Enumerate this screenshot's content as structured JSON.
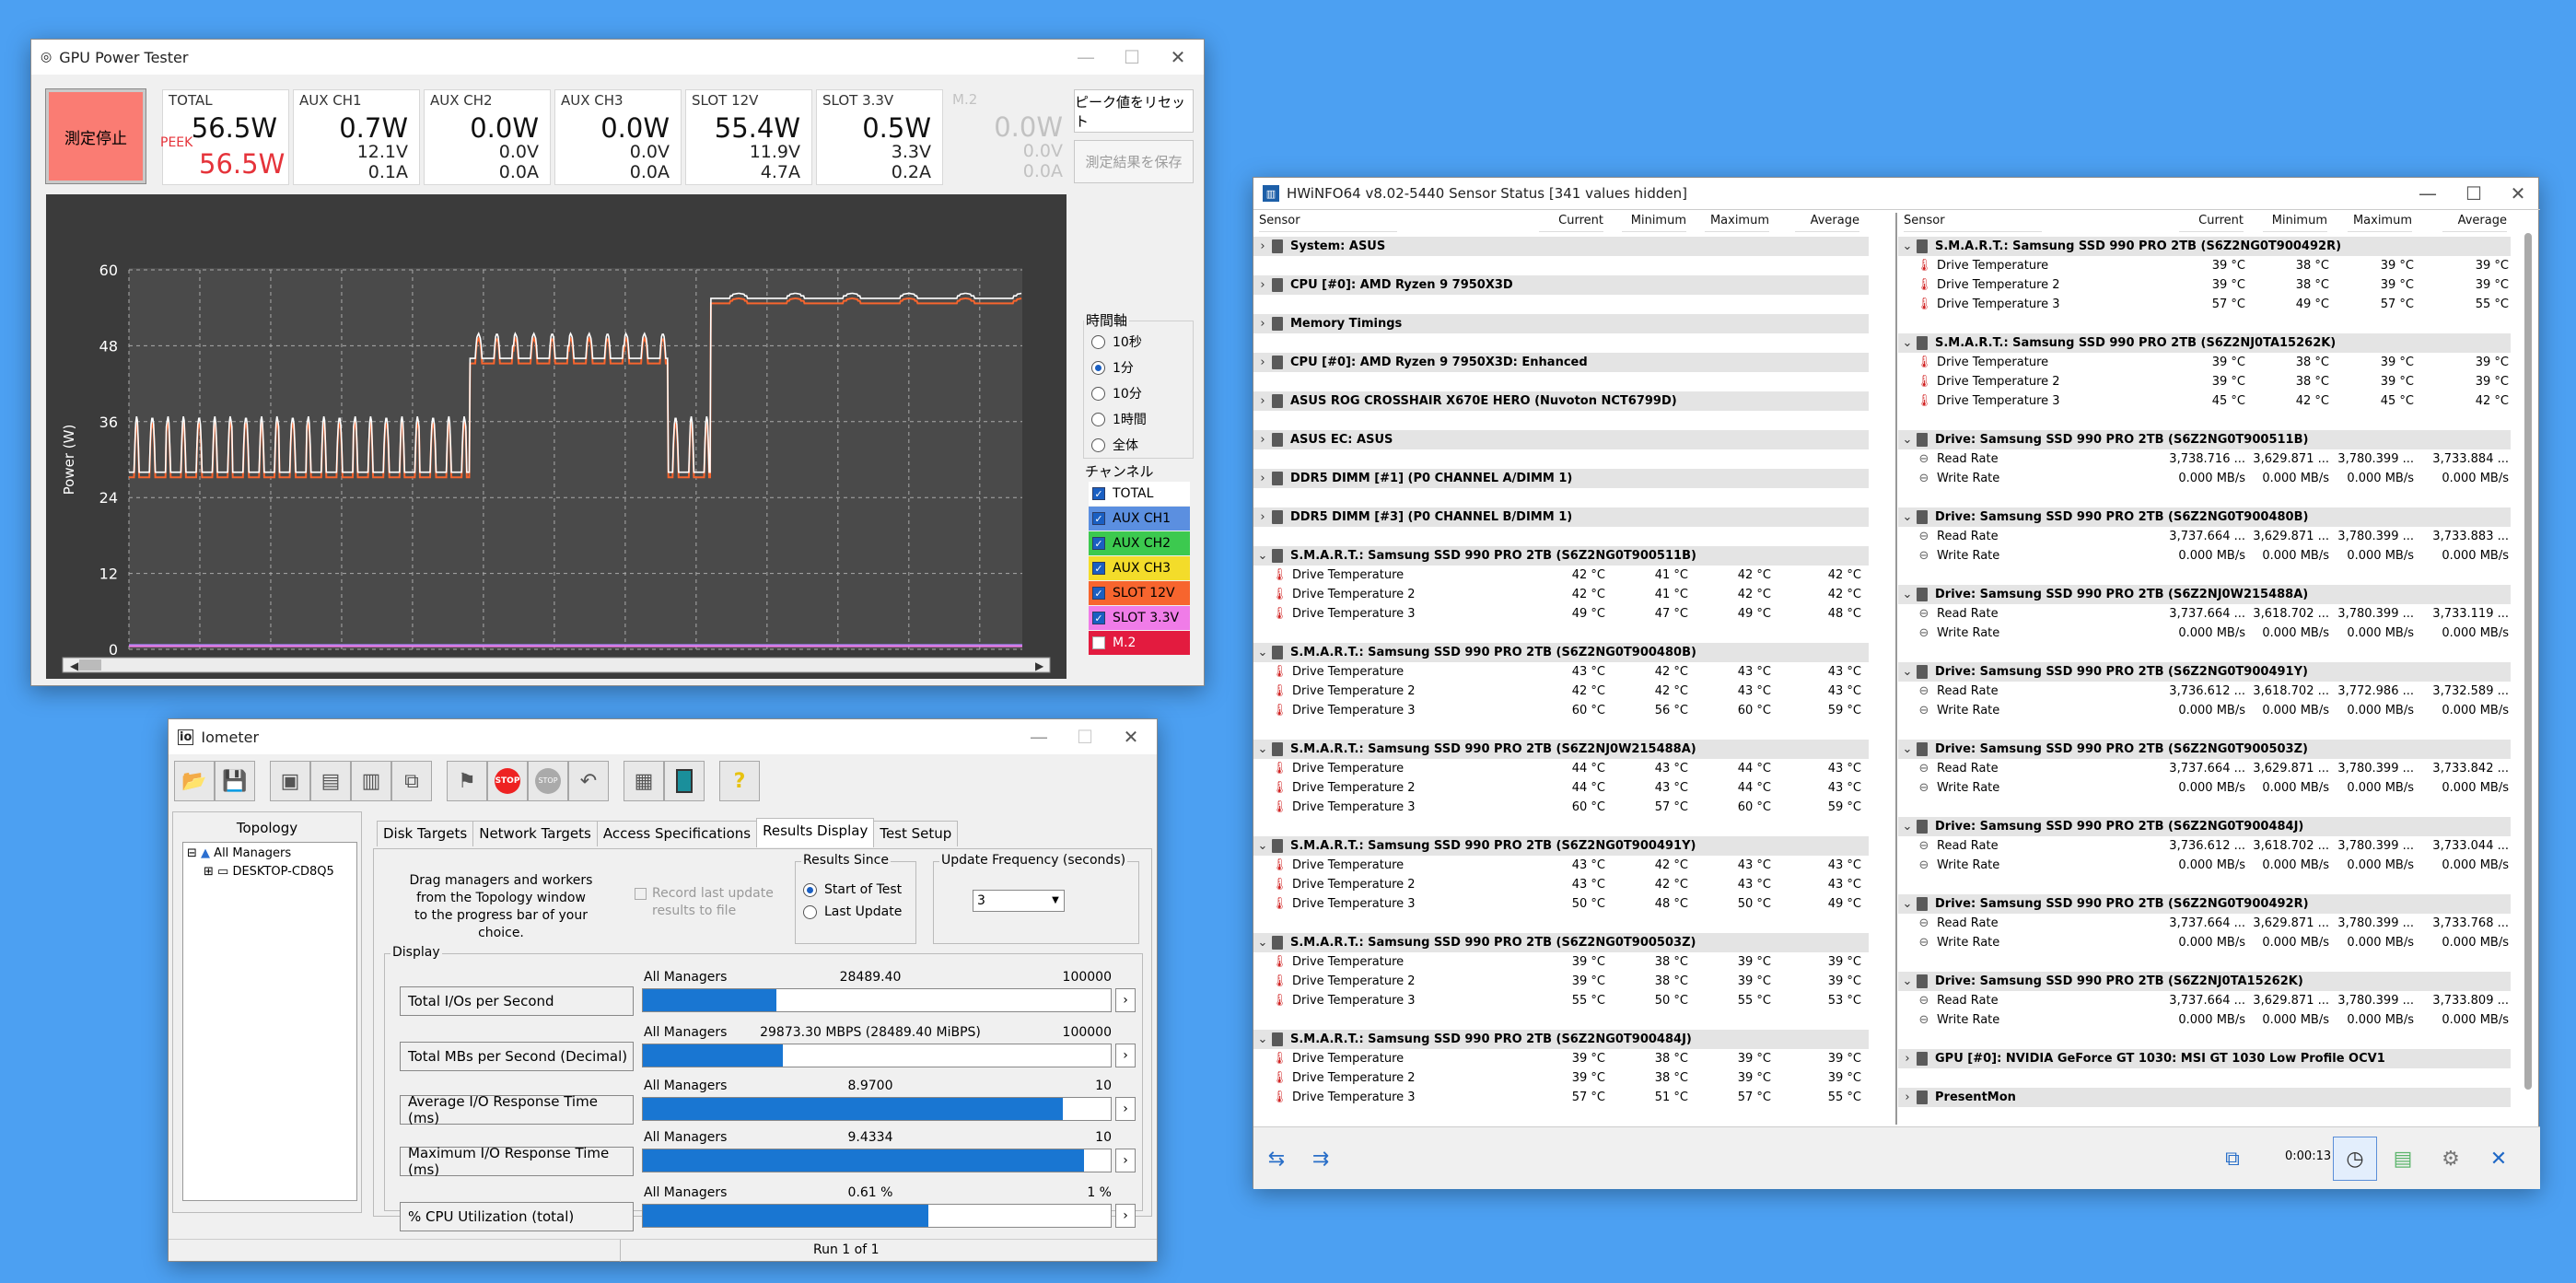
{
  "gpu": {
    "title": "GPU Power Tester",
    "stop_label": "測定停止",
    "channels": [
      {
        "name": "TOTAL",
        "power": "56.5W",
        "voltage": "",
        "current": "",
        "dim": false
      },
      {
        "name": "AUX CH1",
        "power": "0.7W",
        "voltage": "12.1V",
        "current": "0.1A",
        "dim": false
      },
      {
        "name": "AUX CH2",
        "power": "0.0W",
        "voltage": "0.0V",
        "current": "0.0A",
        "dim": false
      },
      {
        "name": "AUX CH3",
        "power": "0.0W",
        "voltage": "0.0V",
        "current": "0.0A",
        "dim": false
      },
      {
        "name": "SLOT 12V",
        "power": "55.4W",
        "voltage": "11.9V",
        "current": "4.7A",
        "dim": false
      },
      {
        "name": "SLOT 3.3V",
        "power": "0.5W",
        "voltage": "3.3V",
        "current": "0.2A",
        "dim": false
      },
      {
        "name": "M.2",
        "power": "0.0W",
        "voltage": "0.0V",
        "current": "0.0A",
        "dim": true
      }
    ],
    "peek_label": "PEEK",
    "peek_value": "56.5W",
    "reset_peak": "ピーク値をリセット",
    "save_results": "測定結果を保存",
    "time_axis_title": "時間軸",
    "time_options": [
      "10秒",
      "1分",
      "10分",
      "1時間",
      "全体"
    ],
    "time_selected": 1,
    "channel_title": "チャンネル",
    "channel_list": [
      {
        "label": "TOTAL",
        "color": "#ffffff",
        "checked": true
      },
      {
        "label": "AUX CH1",
        "color": "#5b8fe0",
        "checked": true
      },
      {
        "label": "AUX CH2",
        "color": "#3cc94f",
        "checked": true
      },
      {
        "label": "AUX CH3",
        "color": "#f3dc2a",
        "checked": true
      },
      {
        "label": "SLOT 12V",
        "color": "#f7652e",
        "checked": true
      },
      {
        "label": "SLOT 3.3V",
        "color": "#f07ce8",
        "checked": true
      },
      {
        "label": "M.2",
        "color": "#e31b3f",
        "checked": false
      }
    ]
  },
  "chart_data": {
    "type": "line",
    "ylabel": "Power (W)",
    "xlabel": "",
    "xlim": [
      0,
      63
    ],
    "ylim": [
      0,
      60
    ],
    "xticks": [
      15,
      30,
      45,
      60
    ],
    "yticks": [
      0,
      12,
      24,
      36,
      48,
      60
    ],
    "grid": true,
    "series": [
      {
        "color": "#ffffff",
        "segments": [
          {
            "from": 0,
            "to": 24,
            "base": 28,
            "peak": 37,
            "period": 1.1
          },
          {
            "from": 24,
            "to": 38,
            "base": 46,
            "peak": 50,
            "period": 1.3
          },
          {
            "from": 38,
            "to": 41,
            "base": 28,
            "peak": 37,
            "period": 1.1
          },
          {
            "from": 41,
            "to": 63,
            "base": 55.5,
            "peak": 56.3,
            "period": 4
          }
        ]
      },
      {
        "color": "#f7652e",
        "offset": -0.8
      },
      {
        "color": "#9c7fe6",
        "flat": 0.7
      },
      {
        "color": "#f07ce8",
        "flat": 0.5
      }
    ]
  },
  "iometer": {
    "title": "Iometer",
    "topology_tab": "Topology",
    "tree": [
      "All Managers",
      "DESKTOP-CD8Q5"
    ],
    "tabs": [
      "Disk Targets",
      "Network Targets",
      "Access Specifications",
      "Results Display",
      "Test Setup"
    ],
    "active_tab": 3,
    "drag_text": [
      "Drag managers and workers",
      "from the Topology window",
      "to the progress bar of your choice."
    ],
    "record_text": [
      "Record last update",
      "results to file"
    ],
    "results_since": "Results Since",
    "start_of_test": "Start of Test",
    "last_update": "Last Update",
    "update_freq": "Update Frequency (seconds)",
    "update_value": "3",
    "display_label": "Display",
    "metrics": [
      {
        "label": "Total I/Os per Second",
        "scope": "All Managers",
        "value": "28489.40",
        "max": "100000",
        "frac": 0.285
      },
      {
        "label": "Total MBs per Second (Decimal)",
        "scope": "All Managers",
        "value": "29873.30 MBPS (28489.40 MiBPS)",
        "max": "100000",
        "frac": 0.299
      },
      {
        "label": "Average I/O Response Time (ms)",
        "scope": "All Managers",
        "value": "8.9700",
        "max": "10",
        "frac": 0.897
      },
      {
        "label": "Maximum I/O Response Time (ms)",
        "scope": "All Managers",
        "value": "9.4334",
        "max": "10",
        "frac": 0.943
      },
      {
        "label": "% CPU Utilization (total)",
        "scope": "All Managers",
        "value": "0.61 %",
        "max": "1 %",
        "frac": 0.61
      }
    ],
    "status": "Run 1 of 1"
  },
  "hwinfo": {
    "title": "HWiNFO64 v8.02-5440 Sensor Status [341 values hidden]",
    "headers": [
      "Sensor",
      "Current",
      "Minimum",
      "Maximum",
      "Average"
    ],
    "left": [
      {
        "g": "System: ASUS"
      },
      {
        "g": "CPU [#0]: AMD Ryzen 9 7950X3D"
      },
      {
        "g": "Memory Timings"
      },
      {
        "g": "CPU [#0]: AMD Ryzen 9 7950X3D: Enhanced"
      },
      {
        "g": "ASUS ROG CROSSHAIR X670E HERO (Nuvoton NCT6799D)"
      },
      {
        "g": "ASUS EC: ASUS"
      },
      {
        "g": "DDR5 DIMM [#1] (P0 CHANNEL A/DIMM 1)"
      },
      {
        "g": "DDR5 DIMM [#3] (P0 CHANNEL B/DIMM 1)"
      },
      {
        "g": "S.M.A.R.T.: Samsung SSD 990 PRO 2TB (S6Z2NG0T900511B)",
        "open": true,
        "rows": [
          [
            "Drive Temperature",
            "42 °C",
            "41 °C",
            "42 °C",
            "42 °C"
          ],
          [
            "Drive Temperature 2",
            "42 °C",
            "41 °C",
            "42 °C",
            "42 °C"
          ],
          [
            "Drive Temperature 3",
            "49 °C",
            "47 °C",
            "49 °C",
            "48 °C"
          ]
        ]
      },
      {
        "g": "S.M.A.R.T.: Samsung SSD 990 PRO 2TB (S6Z2NG0T900480B)",
        "open": true,
        "rows": [
          [
            "Drive Temperature",
            "43 °C",
            "42 °C",
            "43 °C",
            "43 °C"
          ],
          [
            "Drive Temperature 2",
            "42 °C",
            "42 °C",
            "43 °C",
            "43 °C"
          ],
          [
            "Drive Temperature 3",
            "60 °C",
            "56 °C",
            "60 °C",
            "59 °C"
          ]
        ]
      },
      {
        "g": "S.M.A.R.T.: Samsung SSD 990 PRO 2TB (S6Z2NJ0W215488A)",
        "open": true,
        "rows": [
          [
            "Drive Temperature",
            "44 °C",
            "43 °C",
            "44 °C",
            "43 °C"
          ],
          [
            "Drive Temperature 2",
            "44 °C",
            "43 °C",
            "44 °C",
            "43 °C"
          ],
          [
            "Drive Temperature 3",
            "60 °C",
            "57 °C",
            "60 °C",
            "59 °C"
          ]
        ]
      },
      {
        "g": "S.M.A.R.T.: Samsung SSD 990 PRO 2TB (S6Z2NG0T900491Y)",
        "open": true,
        "rows": [
          [
            "Drive Temperature",
            "43 °C",
            "42 °C",
            "43 °C",
            "43 °C"
          ],
          [
            "Drive Temperature 2",
            "43 °C",
            "42 °C",
            "43 °C",
            "43 °C"
          ],
          [
            "Drive Temperature 3",
            "50 °C",
            "48 °C",
            "50 °C",
            "49 °C"
          ]
        ]
      },
      {
        "g": "S.M.A.R.T.: Samsung SSD 990 PRO 2TB (S6Z2NG0T900503Z)",
        "open": true,
        "rows": [
          [
            "Drive Temperature",
            "39 °C",
            "38 °C",
            "39 °C",
            "39 °C"
          ],
          [
            "Drive Temperature 2",
            "39 °C",
            "38 °C",
            "39 °C",
            "39 °C"
          ],
          [
            "Drive Temperature 3",
            "55 °C",
            "50 °C",
            "55 °C",
            "53 °C"
          ]
        ]
      },
      {
        "g": "S.M.A.R.T.: Samsung SSD 990 PRO 2TB (S6Z2NG0T900484J)",
        "open": true,
        "rows": [
          [
            "Drive Temperature",
            "39 °C",
            "38 °C",
            "39 °C",
            "39 °C"
          ],
          [
            "Drive Temperature 2",
            "39 °C",
            "38 °C",
            "39 °C",
            "39 °C"
          ],
          [
            "Drive Temperature 3",
            "57 °C",
            "51 °C",
            "57 °C",
            "55 °C"
          ]
        ]
      }
    ],
    "right": [
      {
        "g": "S.M.A.R.T.: Samsung SSD 990 PRO 2TB (S6Z2NG0T900492R)",
        "open": true,
        "rows": [
          [
            "Drive Temperature",
            "39 °C",
            "38 °C",
            "39 °C",
            "39 °C"
          ],
          [
            "Drive Temperature 2",
            "39 °C",
            "38 °C",
            "39 °C",
            "39 °C"
          ],
          [
            "Drive Temperature 3",
            "57 °C",
            "49 °C",
            "57 °C",
            "55 °C"
          ]
        ]
      },
      {
        "g": "S.M.A.R.T.: Samsung SSD 990 PRO 2TB (S6Z2NJ0TA15262K)",
        "open": true,
        "rows": [
          [
            "Drive Temperature",
            "39 °C",
            "38 °C",
            "39 °C",
            "39 °C"
          ],
          [
            "Drive Temperature 2",
            "39 °C",
            "38 °C",
            "39 °C",
            "39 °C"
          ],
          [
            "Drive Temperature 3",
            "45 °C",
            "42 °C",
            "45 °C",
            "42 °C"
          ]
        ]
      },
      {
        "g": "Drive: Samsung SSD 990 PRO 2TB (S6Z2NG0T900511B)",
        "open": true,
        "rw": true,
        "rows": [
          [
            "Read Rate",
            "3,738.716 ...",
            "3,629.871 ...",
            "3,780.399 ...",
            "3,733.884 ..."
          ],
          [
            "Write Rate",
            "0.000 MB/s",
            "0.000 MB/s",
            "0.000 MB/s",
            "0.000 MB/s"
          ]
        ]
      },
      {
        "g": "Drive: Samsung SSD 990 PRO 2TB (S6Z2NG0T900480B)",
        "open": true,
        "rw": true,
        "rows": [
          [
            "Read Rate",
            "3,737.664 ...",
            "3,629.871 ...",
            "3,780.399 ...",
            "3,733.883 ..."
          ],
          [
            "Write Rate",
            "0.000 MB/s",
            "0.000 MB/s",
            "0.000 MB/s",
            "0.000 MB/s"
          ]
        ]
      },
      {
        "g": "Drive: Samsung SSD 990 PRO 2TB (S6Z2NJ0W215488A)",
        "open": true,
        "rw": true,
        "rows": [
          [
            "Read Rate",
            "3,737.664 ...",
            "3,618.702 ...",
            "3,780.399 ...",
            "3,733.119 ..."
          ],
          [
            "Write Rate",
            "0.000 MB/s",
            "0.000 MB/s",
            "0.000 MB/s",
            "0.000 MB/s"
          ]
        ]
      },
      {
        "g": "Drive: Samsung SSD 990 PRO 2TB (S6Z2NG0T900491Y)",
        "open": true,
        "rw": true,
        "rows": [
          [
            "Read Rate",
            "3,736.612 ...",
            "3,618.702 ...",
            "3,772.986 ...",
            "3,732.589 ..."
          ],
          [
            "Write Rate",
            "0.000 MB/s",
            "0.000 MB/s",
            "0.000 MB/s",
            "0.000 MB/s"
          ]
        ]
      },
      {
        "g": "Drive: Samsung SSD 990 PRO 2TB (S6Z2NG0T900503Z)",
        "open": true,
        "rw": true,
        "rows": [
          [
            "Read Rate",
            "3,737.664 ...",
            "3,629.871 ...",
            "3,780.399 ...",
            "3,733.842 ..."
          ],
          [
            "Write Rate",
            "0.000 MB/s",
            "0.000 MB/s",
            "0.000 MB/s",
            "0.000 MB/s"
          ]
        ]
      },
      {
        "g": "Drive: Samsung SSD 990 PRO 2TB (S6Z2NG0T900484J)",
        "open": true,
        "rw": true,
        "rows": [
          [
            "Read Rate",
            "3,736.612 ...",
            "3,618.702 ...",
            "3,780.399 ...",
            "3,733.044 ..."
          ],
          [
            "Write Rate",
            "0.000 MB/s",
            "0.000 MB/s",
            "0.000 MB/s",
            "0.000 MB/s"
          ]
        ]
      },
      {
        "g": "Drive: Samsung SSD 990 PRO 2TB (S6Z2NG0T900492R)",
        "open": true,
        "rw": true,
        "rows": [
          [
            "Read Rate",
            "3,737.664 ...",
            "3,629.871 ...",
            "3,780.399 ...",
            "3,733.768 ..."
          ],
          [
            "Write Rate",
            "0.000 MB/s",
            "0.000 MB/s",
            "0.000 MB/s",
            "0.000 MB/s"
          ]
        ]
      },
      {
        "g": "Drive: Samsung SSD 990 PRO 2TB (S6Z2NJ0TA15262K)",
        "open": true,
        "rw": true,
        "rows": [
          [
            "Read Rate",
            "3,737.664 ...",
            "3,629.871 ...",
            "3,780.399 ...",
            "3,733.809 ..."
          ],
          [
            "Write Rate",
            "0.000 MB/s",
            "0.000 MB/s",
            "0.000 MB/s",
            "0.000 MB/s"
          ]
        ]
      },
      {
        "g": "GPU [#0]: NVIDIA GeForce GT 1030: MSI GT 1030 Low Profile OCV1"
      },
      {
        "g": "PresentMon"
      }
    ],
    "timer": "0:00:13"
  }
}
